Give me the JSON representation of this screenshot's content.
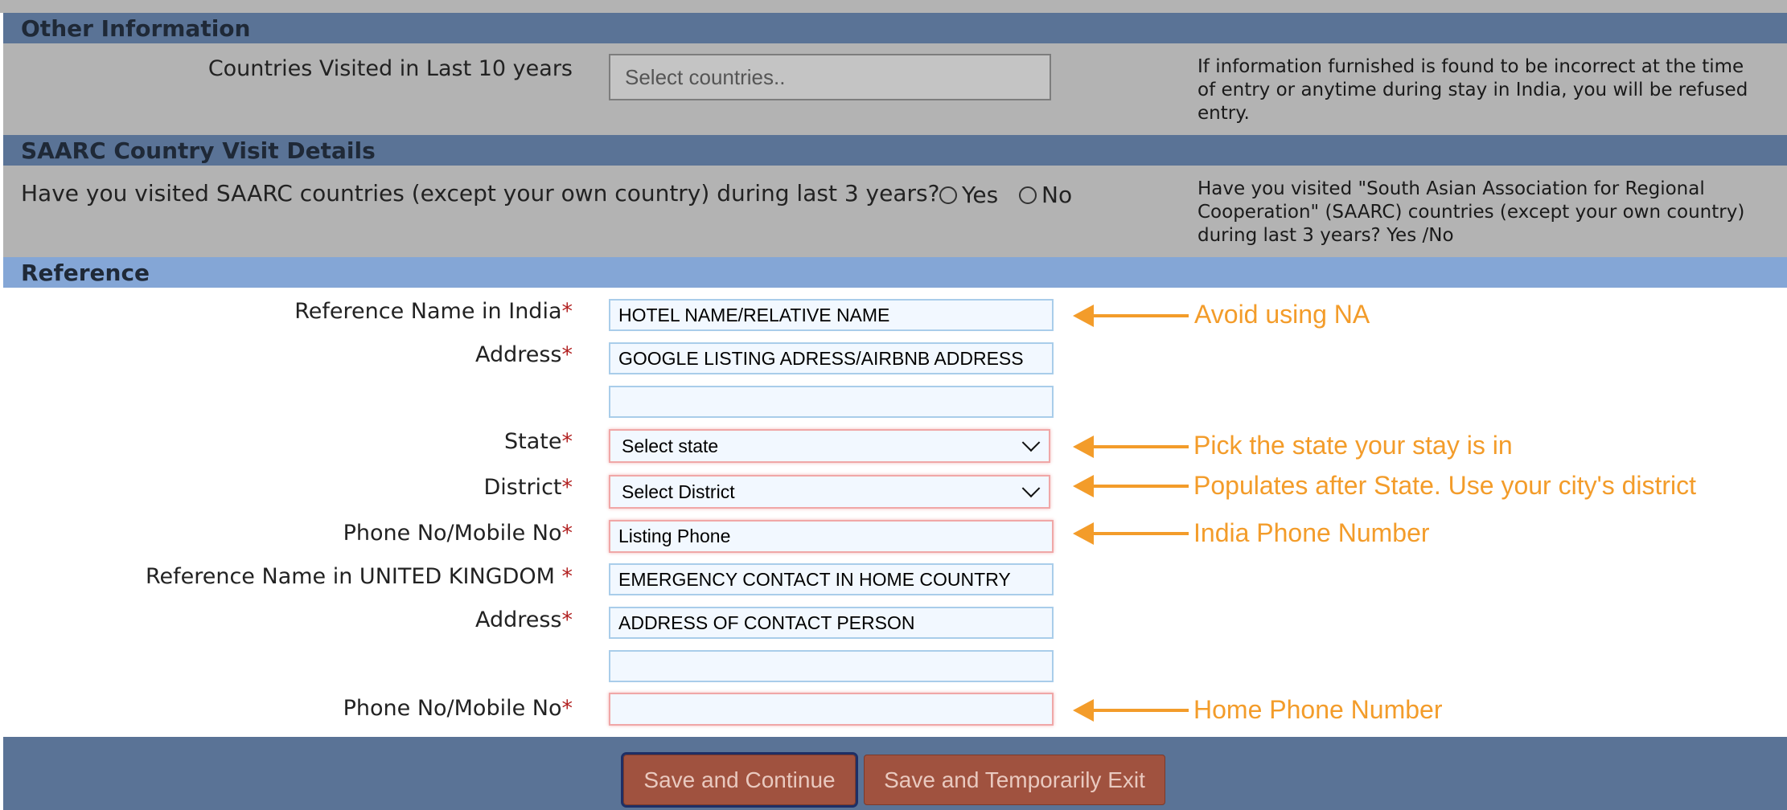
{
  "other_information": {
    "header": "Other Information",
    "countries_label": "Countries Visited in Last 10 years",
    "countries_placeholder": "Select countries..",
    "help": "If information furnished is found to be incorrect at the time of entry or anytime during stay in India, you will be refused entry."
  },
  "saarc": {
    "header": "SAARC Country Visit Details",
    "question": "Have you visited SAARC countries (except your own country) during last 3 years?",
    "yes": "Yes",
    "no": "No",
    "help": "Have you visited \"South Asian Association for Regional Cooperation\" (SAARC) countries (except your own country) during last 3 years? Yes /No"
  },
  "reference": {
    "header": "Reference",
    "required_mark": "*",
    "india_name_label": "Reference Name in India",
    "india_name_value": "HOTEL NAME/RELATIVE NAME",
    "india_address_label": "Address",
    "india_address_value": "GOOGLE LISTING ADRESS/AIRBNB ADDRESS",
    "india_address_line2": "",
    "state_label": "State",
    "state_value": "Select state",
    "district_label": "District",
    "district_value": "Select District",
    "india_phone_label": "Phone No/Mobile No",
    "india_phone_value": "Listing Phone",
    "home_name_label": "Reference Name in UNITED KINGDOM ",
    "home_name_value": "EMERGENCY CONTACT IN HOME COUNTRY",
    "home_address_label": "Address",
    "home_address_value": "ADDRESS OF CONTACT PERSON",
    "home_address_line2": "",
    "home_phone_label": "Phone No/Mobile No",
    "home_phone_value": ""
  },
  "annotations": {
    "name": "Avoid using NA",
    "state": "Pick the state your stay is in",
    "district": "Populates after State. Use your city's district",
    "india_phone": "India Phone Number",
    "home_phone": "Home Phone Number",
    "color": "#f39c2a"
  },
  "footer": {
    "save_continue": "Save and Continue",
    "save_exit": "Save and Temporarily Exit"
  }
}
